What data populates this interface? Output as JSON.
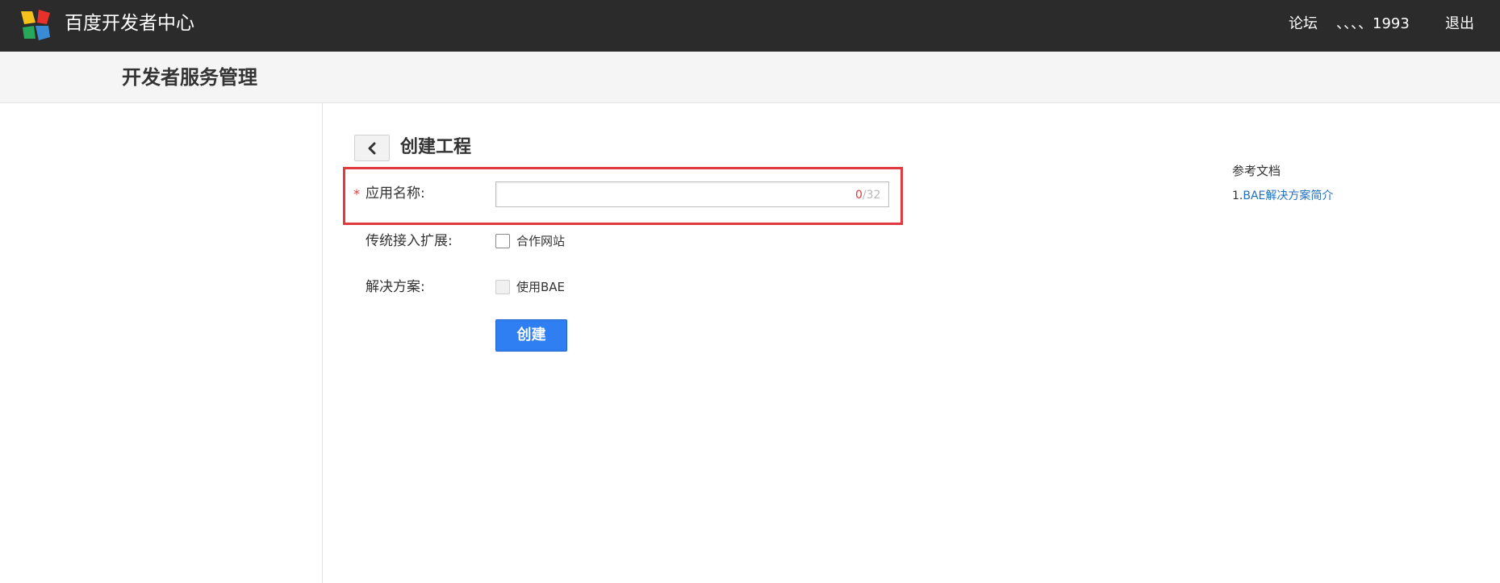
{
  "header": {
    "brand": "百度开发者中心",
    "nav": {
      "forum": "论坛",
      "user": "、、、、1993",
      "logout": "退出"
    },
    "logo_colors": [
      "#e8312a",
      "#f5c21b",
      "#3a8bd6",
      "#27a85b"
    ]
  },
  "subheader": {
    "title": "开发者服务管理"
  },
  "main": {
    "back_icon": "chevron-left-icon",
    "title": "创建工程",
    "form": {
      "name_label": "应用名称:",
      "required_mark": "*",
      "name_value": "",
      "counter_current": "0",
      "counter_max": "/32",
      "extension_label": "传统接入扩展:",
      "partner_checkbox_label": "合作网站",
      "solution_label": "解决方案:",
      "bae_checkbox_label": "使用BAE",
      "create_button": "创建"
    }
  },
  "reference": {
    "title": "参考文档",
    "items": [
      {
        "index": "1.",
        "label": "BAE解决方案简介"
      }
    ]
  },
  "colors": {
    "topbar": "#2b2b2b",
    "primary_button": "#2f7ef2",
    "highlight": "#e0393e",
    "link": "#1f6fbf"
  }
}
